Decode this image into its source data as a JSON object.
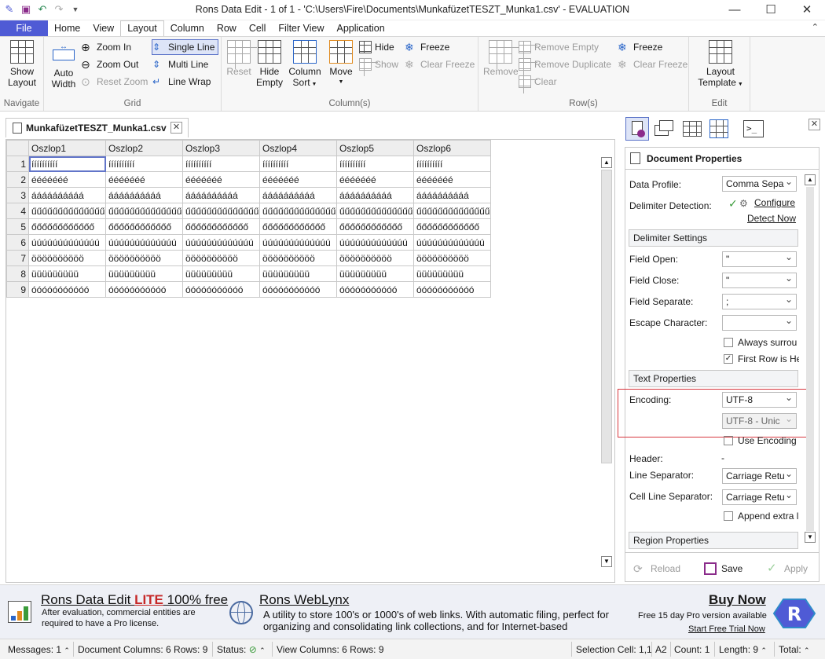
{
  "window": {
    "title": "Rons Data Edit - 1 of 1 - 'C:\\Users\\Fire\\Documents\\MunkafüzetTESZT_Munka1.csv' - EVALUATION",
    "minimize": "—",
    "maximize": "☐",
    "close": "✕"
  },
  "menu": {
    "file": "File",
    "items": [
      "Home",
      "View",
      "Layout",
      "Column",
      "Row",
      "Cell",
      "Filter View",
      "Application"
    ],
    "active": "Layout"
  },
  "ribbon": {
    "navigate": {
      "label": "Navigate",
      "show_layout": "Show\nLayout"
    },
    "grid": {
      "label": "Grid",
      "auto_width": "Auto\nWidth",
      "zoom_in": "Zoom In",
      "zoom_out": "Zoom Out",
      "reset_zoom": "Reset Zoom",
      "single_line": "Single Line",
      "multi_line": "Multi Line",
      "line_wrap": "Line Wrap"
    },
    "columns": {
      "label": "Column(s)",
      "reset": "Reset",
      "hide_empty": "Hide\nEmpty",
      "column_sort": "Column\nSort",
      "move": "Move",
      "hide": "Hide",
      "show": "Show",
      "freeze": "Freeze",
      "clear_freeze": "Clear Freeze"
    },
    "rows": {
      "label": "Row(s)",
      "remove": "Remove",
      "remove_empty": "Remove Empty",
      "remove_duplicate": "Remove Duplicate",
      "clear": "Clear",
      "freeze": "Freeze",
      "clear_freeze": "Clear Freeze"
    },
    "edit": {
      "label": "Edit",
      "layout_template": "Layout\nTemplate"
    }
  },
  "document_tab": {
    "name": "MunkafüzetTESZT_Munka1.csv",
    "close": "✕"
  },
  "grid": {
    "columns": [
      "Oszlop1",
      "Oszlop2",
      "Oszlop3",
      "Oszlop4",
      "Oszlop5",
      "Oszlop6"
    ],
    "rows": [
      {
        "n": "1",
        "value": "íííííííííí"
      },
      {
        "n": "2",
        "value": "ééééééé"
      },
      {
        "n": "3",
        "value": "áááááááááá"
      },
      {
        "n": "4",
        "value": "űűűűűűűűűűűűűű"
      },
      {
        "n": "5",
        "value": "őőőőőőőőőőőő"
      },
      {
        "n": "6",
        "value": "úúúúúúúúúúúúú"
      },
      {
        "n": "7",
        "value": "öööööööööö"
      },
      {
        "n": "8",
        "value": "üüüüüüüüü"
      },
      {
        "n": "9",
        "value": "óóóóóóóóóóó"
      }
    ]
  },
  "panel": {
    "title": "Document Properties",
    "data_profile_label": "Data Profile:",
    "data_profile_value": "Comma Sepa",
    "delimiter_detection_label": "Delimiter Detection:",
    "configure": "Configure",
    "detect_now": "Detect Now",
    "delimiter_settings": "Delimiter Settings",
    "field_open_label": "Field Open:",
    "field_open_value": "\"",
    "field_close_label": "Field Close:",
    "field_close_value": "\"",
    "field_separate_label": "Field Separate:",
    "field_separate_value": ";",
    "escape_label": "Escape Character:",
    "escape_value": "",
    "always_surround": "Always surrou",
    "first_row_header": "First Row is He",
    "text_properties": "Text Properties",
    "encoding_label": "Encoding:",
    "encoding_value": "UTF-8",
    "encoding_sub_value": "UTF-8 - Unic",
    "use_encoding": "Use Encoding",
    "header_label": "Header:",
    "header_value": "-",
    "line_separator_label": "Line Separator:",
    "line_separator_value": "Carriage Retu",
    "cell_line_separator_label": "Cell Line Separator:",
    "cell_line_separator_value": "Carriage Retu",
    "append_extra": "Append extra l",
    "region_properties": "Region Properties",
    "reload": "Reload",
    "save": "Save",
    "apply": "Apply"
  },
  "ads": {
    "rde_title_prefix": "Rons Data Edit ",
    "rde_title_lite": "LITE",
    "rde_title_suffix": " 100% free",
    "rde_sub": "After evaluation, commercial entities are required to have a Pro license.",
    "weblynx_title": "Rons WebLynx",
    "weblynx_sub": "A utility to store 100's or 1000's of web links. With automatic filing, perfect for organizing and consolidating link collections, and for Internet-based",
    "buy_now": "Buy Now",
    "trial_text": "Free 15 day Pro version available",
    "start_trial": "Start Free Trial Now"
  },
  "status": {
    "messages": "Messages: 1",
    "doc_columns": "Document Columns: 6 Rows: 9",
    "status_label": "Status:",
    "view_columns": "View Columns: 6 Rows: 9",
    "selection": "Selection Cell: 1,1",
    "cell_ref": "A2",
    "count": "Count: 1",
    "length": "Length: 9",
    "total": "Total:"
  },
  "colors": {
    "accent": "#4f5bd5",
    "highlight": "#d8383f",
    "lite": "#c62828"
  }
}
